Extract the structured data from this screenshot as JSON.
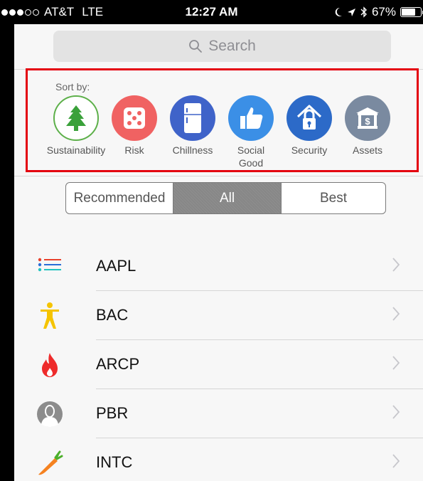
{
  "status_bar": {
    "carrier": "AT&T",
    "network": "LTE",
    "time": "12:27 AM",
    "battery_percent": "67%",
    "signal_bars_filled": 3,
    "signal_bars_total": 5
  },
  "search": {
    "placeholder": "Search"
  },
  "sort": {
    "label": "Sort by:",
    "categories": [
      {
        "label": "Sustainability",
        "icon": "tree-icon",
        "color": "#ffffff",
        "ring": "#5db04a",
        "glyph": "#3aa13a"
      },
      {
        "label": "Risk",
        "icon": "dice-icon",
        "color": "#f06262"
      },
      {
        "label": "Chillness",
        "icon": "fridge-icon",
        "color": "#3f63c9"
      },
      {
        "label": "Social\nGood",
        "icon": "thumbs-up-icon",
        "color": "#3b8fe6"
      },
      {
        "label": "Security",
        "icon": "lock-icon",
        "color": "#2c6ac8"
      },
      {
        "label": "Assets",
        "icon": "bank-icon",
        "color": "#7a8aa0"
      }
    ]
  },
  "segments": {
    "items": [
      "Recommended",
      "All",
      "Best"
    ],
    "selected": "All"
  },
  "stocks": [
    {
      "ticker": "AAPL",
      "icon": "list-icon"
    },
    {
      "ticker": "BAC",
      "icon": "person-icon"
    },
    {
      "ticker": "ARCP",
      "icon": "flame-icon"
    },
    {
      "ticker": "PBR",
      "icon": "user-silhouette-icon"
    },
    {
      "ticker": "INTC",
      "icon": "carrot-icon"
    }
  ],
  "colors": {
    "highlight": "#e4000f",
    "list_icon_red": "#e8412c",
    "list_icon_blue": "#2a6ed8",
    "list_icon_teal": "#22c4c0",
    "person_yellow": "#f5c400",
    "flame_red": "#ee2b2b",
    "silhouette_gray": "#8c8c8c",
    "carrot_orange": "#f58220",
    "carrot_green": "#4caf2a"
  }
}
